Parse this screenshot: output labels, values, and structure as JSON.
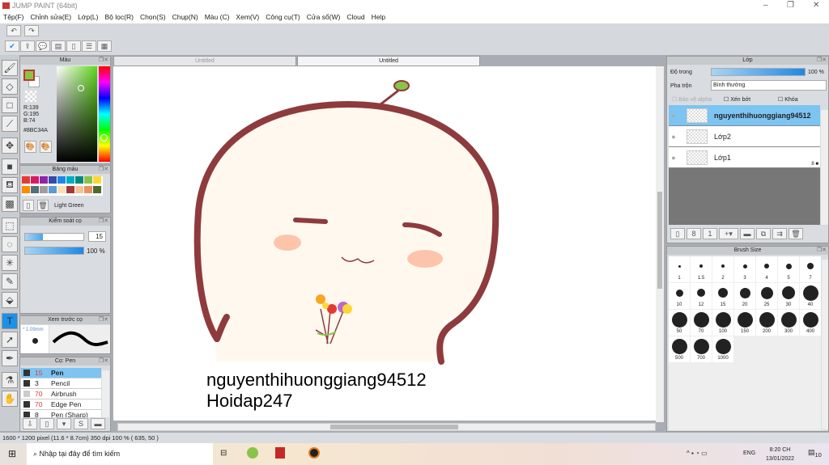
{
  "window": {
    "title": "JUMP PAINT (64bit)"
  },
  "menu": [
    "Tệp(F)",
    "Chỉnh sửa(E)",
    "Lớp(L)",
    "Bộ lọc(R)",
    "Chọn(S)",
    "Chụp(N)",
    "Màu (C)",
    "Xem(V)",
    "Công cụ(T)",
    "Cửa sổ(W)",
    "Cloud",
    "Help"
  ],
  "color_panel": {
    "title": "Màu",
    "r": "R:139",
    "g": "G:195",
    "b": "B:74",
    "hex": "#8BC34A",
    "current": "#8BC34A"
  },
  "palette": {
    "title": "Bảng màu",
    "name": "Light Green",
    "colors": [
      "#e53935",
      "#d81b60",
      "#8e24aa",
      "#3949ab",
      "#1e88e5",
      "#00acc1",
      "#00897b",
      "#8bc34a",
      "#fdd835",
      "#fb8c00",
      "#546e7a",
      "#9e9e9e",
      "#5c9bd6",
      "#ffe0b2",
      "#a1383a",
      "#f5c29a",
      "#e6935f",
      "#4e6b2e"
    ]
  },
  "brush_control": {
    "title": "Kiểm soát cọ",
    "size": "15",
    "opacity": "100 %",
    "size_fraction": 0.3,
    "opacity_fraction": 1.0
  },
  "brush_preview": {
    "title": "Xem trước cọ",
    "size": "* 1.09mm"
  },
  "brush_list": {
    "title": "Cọ: Pen",
    "items": [
      {
        "size": "15",
        "name": "Pen",
        "selected": true
      },
      {
        "size": "3",
        "name": "Pencil"
      },
      {
        "size": "70",
        "name": "Airbrush"
      },
      {
        "size": "70",
        "name": "Edge Pen"
      },
      {
        "size": "8",
        "name": "Pen (Sharp)"
      }
    ]
  },
  "tabs": [
    "Untitled",
    "Untitled"
  ],
  "canvas_text": [
    "nguyenthihuonggiang94512",
    "Hoidap247"
  ],
  "layers": {
    "title": "Lớp",
    "opacity_label": "Độ trong",
    "opacity": "100 %",
    "blend_label": "Pha trộn",
    "blend": "Bình thường",
    "protect_alpha": "Bảo vệ alpha",
    "clip": "Xén bớt",
    "lock": "Khóa",
    "items": [
      {
        "name": "nguyenthihuonggiang94512",
        "selected": true
      },
      {
        "name": "Lớp2"
      },
      {
        "name": "Lớp1",
        "badge": "8"
      }
    ]
  },
  "brush_size": {
    "title": "Brush Size",
    "sizes": [
      "1",
      "1.5",
      "2",
      "3",
      "4",
      "5",
      "7",
      "10",
      "12",
      "15",
      "20",
      "25",
      "30",
      "40",
      "50",
      "70",
      "100",
      "150",
      "200",
      "300",
      "400",
      "500",
      "700",
      "1000"
    ]
  },
  "status": "1600 * 1200 pixel  (11.6 * 8.7cm)  350 dpi  100 %  ( 635, 50 )",
  "taskbar": {
    "search": "Nhập tại đây để tìm kiếm",
    "lang": "ENG",
    "time": "8:20 CH",
    "date": "13/01/2022",
    "notif": "10"
  }
}
